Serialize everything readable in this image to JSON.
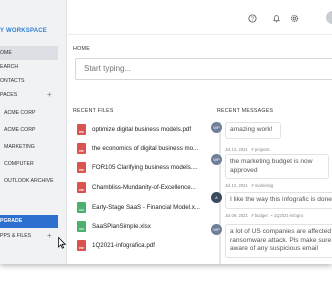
{
  "sidebar": {
    "workspace_title": "Y WORKSPACE",
    "nav": [
      {
        "label": "OME",
        "active": true
      },
      {
        "label": "EARCH",
        "active": false
      },
      {
        "label": "ONTACTS",
        "active": false
      },
      {
        "label": "PACES",
        "active": false
      }
    ],
    "spaces": [
      "ACME CORP",
      "ACME CORP",
      "MARKETING",
      "COMPUTER",
      "OUTLOOK ARCHIVE"
    ],
    "upgrade_label": "PGRADE",
    "apps_label": "PPS & FILES"
  },
  "header": {
    "breadcrumb": "HOME"
  },
  "search": {
    "placeholder": "Start typing..."
  },
  "recent_files": {
    "heading": "RECENT FILES",
    "items": [
      {
        "name": "optimize digital business models.pdf",
        "type": "pdf"
      },
      {
        "name": "the economics of digital business mo...",
        "type": "pdf"
      },
      {
        "name": "FOR105 Clarifying business models....",
        "type": "pdf"
      },
      {
        "name": "Chambliss-Mundanity-of-Excellence...",
        "type": "pdf"
      },
      {
        "name": "Early-Stage SaaS - Financial Model.x...",
        "type": "xls"
      },
      {
        "name": "SaaSPlanSimple.xlsx",
        "type": "xls"
      },
      {
        "name": "1Q2021-infografica.pdf",
        "type": "pdf"
      }
    ]
  },
  "recent_messages": {
    "heading": "RECENT MESSAGES",
    "items": [
      {
        "text": "amazing work!",
        "date": "Jul 12, 2021",
        "channel": "projects",
        "avatar": "WP"
      },
      {
        "text": "the marketing budget is now approved",
        "date": "Jul 12, 2021",
        "channel": "marketing",
        "avatar": "WP"
      },
      {
        "text": "I like the way this infografic is done",
        "date": "Jul 09, 2021",
        "channel": "budget",
        "avatar": "A",
        "extra": "1Q2021-infogra"
      },
      {
        "text": "a lot of US companies are affected by a ransomware attack. Pls make sure to be aware of any suspicious email",
        "date": "",
        "channel": "",
        "avatar": "WP"
      }
    ]
  },
  "colors": {
    "accent": "#2f7fd3",
    "upgrade": "#2d6fcf",
    "pdf": "#d9534f",
    "xls": "#4caf6e"
  }
}
